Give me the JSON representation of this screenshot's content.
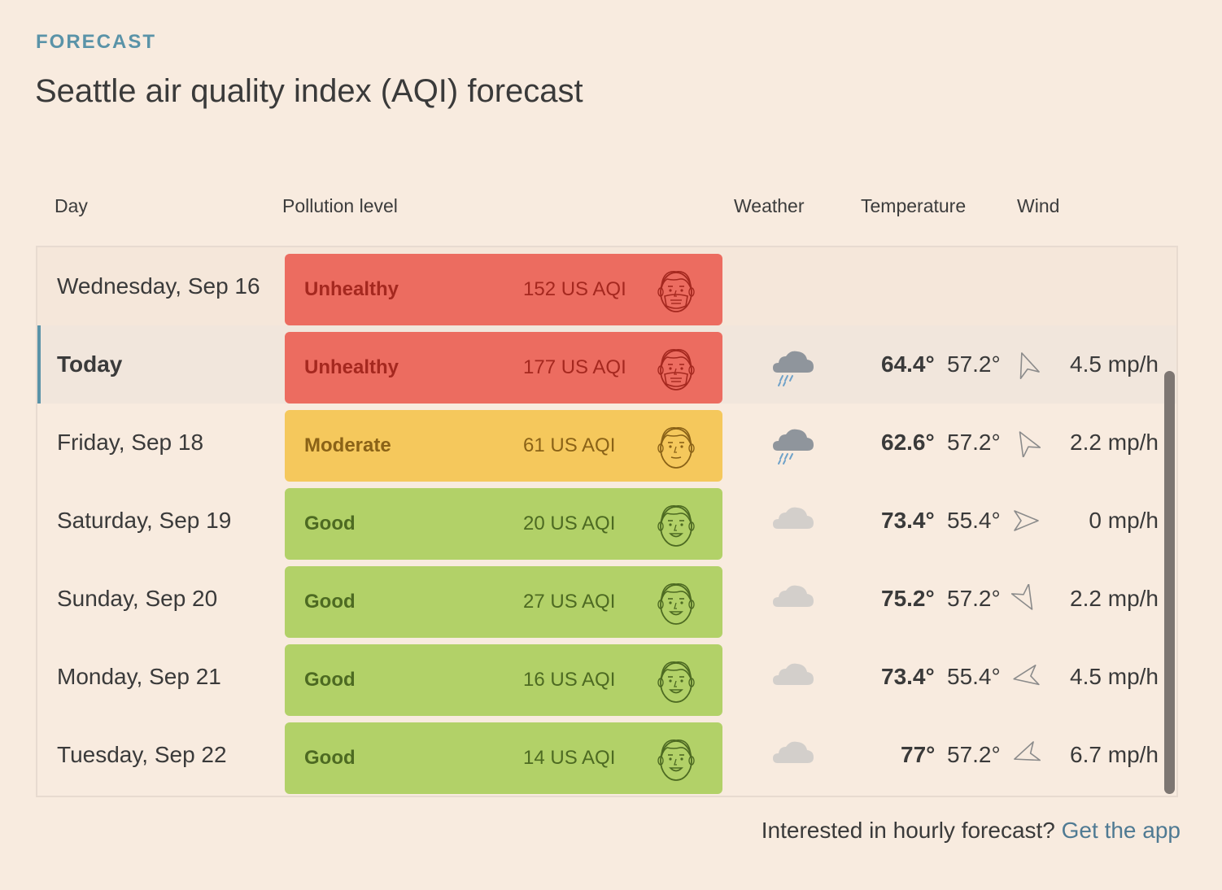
{
  "section_label": "FORECAST",
  "title": "Seattle air quality index (AQI) forecast",
  "headers": {
    "day": "Day",
    "pollution": "Pollution level",
    "weather": "Weather",
    "temperature": "Temperature",
    "wind": "Wind"
  },
  "rows": [
    {
      "day": "Wednesday, Sep 16",
      "level": "Unhealthy",
      "aqi": "152 US AQI",
      "face": "masked-face-icon",
      "weather": "",
      "high": "",
      "low": "",
      "wind": "",
      "wind_dir": null
    },
    {
      "day": "Today",
      "level": "Unhealthy",
      "aqi": "177 US AQI",
      "face": "masked-face-icon",
      "weather": "rain-cloud-icon",
      "high": "64.4°",
      "low": "57.2°",
      "wind": "4.5 mp/h",
      "wind_dir": -20
    },
    {
      "day": "Friday, Sep 18",
      "level": "Moderate",
      "aqi": "61 US AQI",
      "face": "neutral-face-icon",
      "weather": "rain-cloud-icon",
      "high": "62.6°",
      "low": "57.2°",
      "wind": "2.2 mp/h",
      "wind_dir": -30
    },
    {
      "day": "Saturday, Sep 19",
      "level": "Good",
      "aqi": "20 US AQI",
      "face": "smiling-face-icon",
      "weather": "cloud-icon",
      "high": "73.4°",
      "low": "55.4°",
      "wind": "0 mp/h",
      "wind_dir": 90
    },
    {
      "day": "Sunday, Sep 20",
      "level": "Good",
      "aqi": "27 US AQI",
      "face": "smiling-face-icon",
      "weather": "cloud-icon",
      "high": "75.2°",
      "low": "57.2°",
      "wind": "2.2 mp/h",
      "wind_dir": 150
    },
    {
      "day": "Monday, Sep 21",
      "level": "Good",
      "aqi": "16 US AQI",
      "face": "smiling-face-icon",
      "weather": "cloud-icon",
      "high": "73.4°",
      "low": "55.4°",
      "wind": "4.5 mp/h",
      "wind_dir": 260
    },
    {
      "day": "Tuesday, Sep 22",
      "level": "Good",
      "aqi": "14 US AQI",
      "face": "smiling-face-icon",
      "weather": "cloud-icon",
      "high": "77°",
      "low": "57.2°",
      "wind": "6.7 mp/h",
      "wind_dir": 250
    }
  ],
  "level_colors": {
    "Unhealthy": {
      "bg": "#ec6c60",
      "fg": "#a5281f"
    },
    "Moderate": {
      "bg": "#f5c85c",
      "fg": "#8a6217"
    },
    "Good": {
      "bg": "#b2d168",
      "fg": "#4d6a22"
    }
  },
  "footer": {
    "text": "Interested in hourly forecast?",
    "link": "Get the app"
  }
}
